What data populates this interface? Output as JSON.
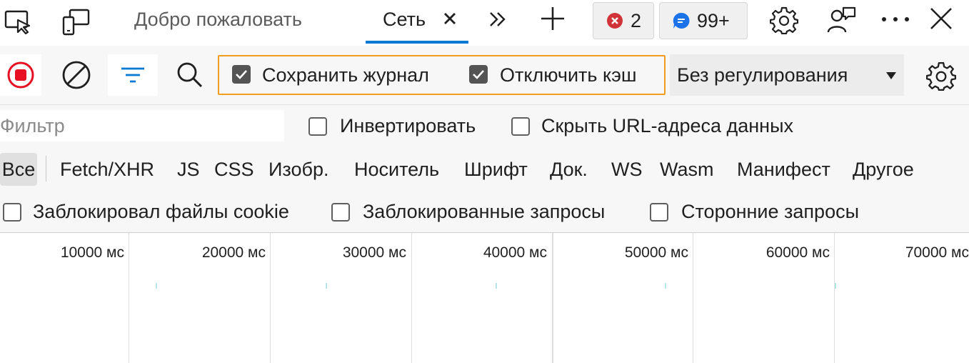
{
  "tabs": {
    "welcome": "Добро пожаловать",
    "network": "Сеть",
    "close": "×",
    "more": "»",
    "add": "+"
  },
  "badges": {
    "errors": "2",
    "messages": "99+",
    "error_color": "#d13438",
    "message_color": "#1a73e8"
  },
  "toolbar": {
    "preserve_log": "Сохранить журнал",
    "preserve_log_checked": true,
    "disable_cache": "Отключить кэш",
    "disable_cache_checked": true,
    "throttling": "Без регулирования",
    "record_color": "#e81123",
    "accent": "#0078d4",
    "highlight": "#f29d1c"
  },
  "filter": {
    "placeholder": "Фильтр",
    "invert": "Инвертировать",
    "hide_data_urls": "Скрыть URL-адреса данных"
  },
  "types": [
    "Все",
    "Fetch/XHR",
    "JS",
    "CSS",
    "Изобр.",
    "Носитель",
    "Шрифт",
    "Док.",
    "WS",
    "Wasm",
    "Манифест",
    "Другое"
  ],
  "blocked": {
    "cookies": "Заблокировал файлы cookie",
    "requests": "Заблокированные запросы",
    "third_party": "Сторонние запросы"
  },
  "timeline": {
    "ticks": [
      "10000 мс",
      "20000 мс",
      "30000 мс",
      "40000 мс",
      "50000 мс",
      "60000 мс",
      "70000 мс"
    ]
  }
}
